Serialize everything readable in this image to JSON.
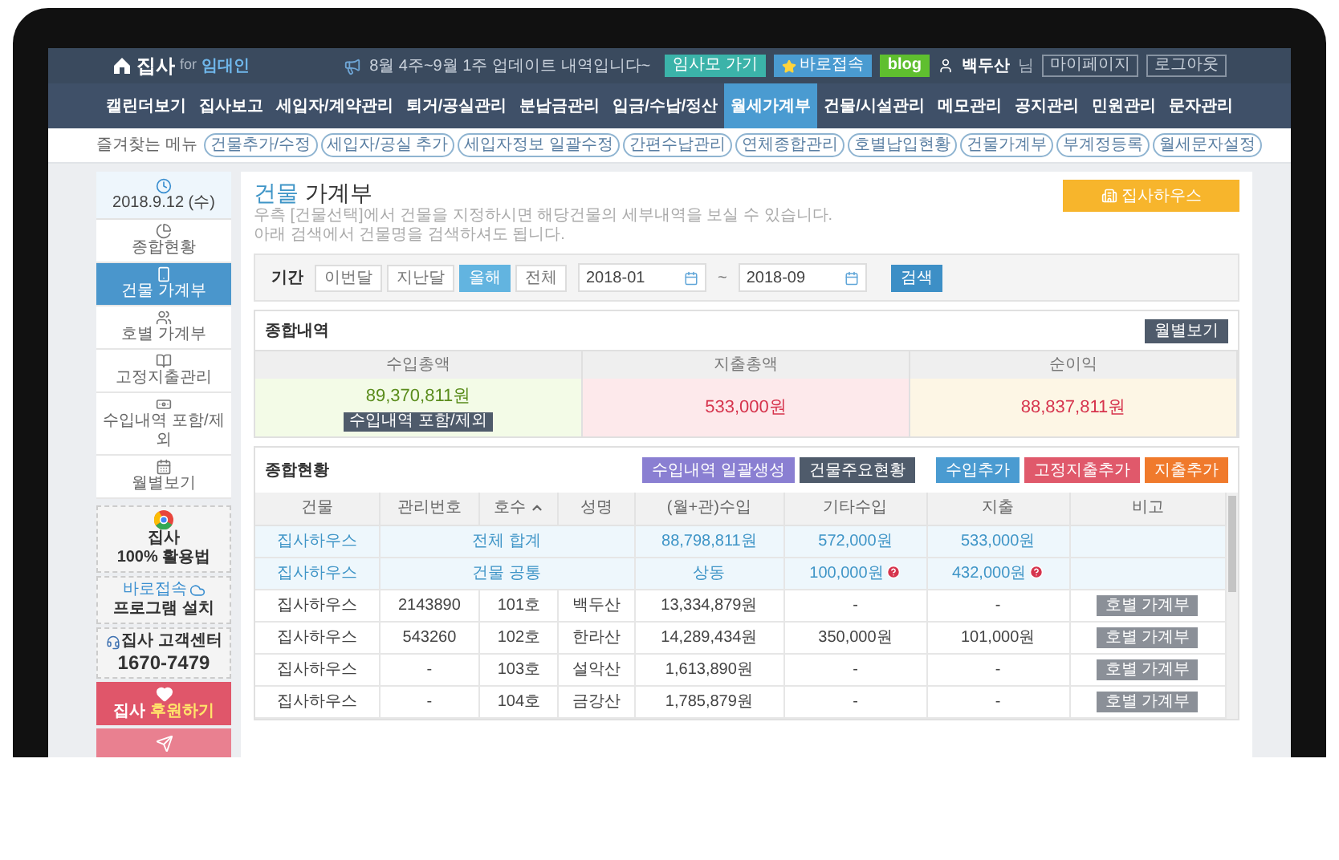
{
  "header": {
    "logo": "집사",
    "logo_for": "for",
    "logo_role": "임대인",
    "notice": "8월 4주~9월 1주 업데이트 내역입니다~",
    "links": [
      {
        "label": "임사모 가기",
        "kind": "community"
      },
      {
        "label": "바로접속",
        "kind": "quick"
      },
      {
        "label": "blog",
        "kind": "blog"
      }
    ],
    "user": "백두산",
    "user_suffix": "님",
    "account_links": [
      "마이페이지",
      "로그아웃"
    ]
  },
  "nav": [
    {
      "label": "캘린더보기",
      "selected": false
    },
    {
      "label": "집사보고",
      "selected": false
    },
    {
      "label": "세입자/계약관리",
      "selected": false
    },
    {
      "label": "퇴거/공실관리",
      "selected": false
    },
    {
      "label": "분납금관리",
      "selected": false
    },
    {
      "label": "입금/수납/정산",
      "selected": false
    },
    {
      "label": "월세가계부",
      "selected": true
    },
    {
      "label": "건물/시설관리",
      "selected": false
    },
    {
      "label": "메모관리",
      "selected": false
    },
    {
      "label": "공지관리",
      "selected": false
    },
    {
      "label": "민원관리",
      "selected": false
    },
    {
      "label": "문자관리",
      "selected": false
    }
  ],
  "favorites": {
    "label": "즐겨찾는 메뉴",
    "items": [
      "건물추가/수정",
      "세입자/공실 추가",
      "세입자정보 일괄수정",
      "간편수납관리",
      "연체종합관리",
      "호별납입현황",
      "건물가계부",
      "부계정등록",
      "월세문자설정"
    ]
  },
  "sidebar": {
    "date": "2018.9.12 (수)",
    "items": [
      {
        "label": "종합현황",
        "selected": false
      },
      {
        "label": "건물 가계부",
        "selected": true
      },
      {
        "label": "호별 가계부",
        "selected": false
      },
      {
        "label": "고정지출관리",
        "selected": false
      },
      {
        "label": "수입내역 포함/제외",
        "selected": false
      },
      {
        "label": "월별보기",
        "selected": false
      }
    ],
    "promos": [
      {
        "kind": "guide",
        "lines": [
          "집사",
          "100% 활용법"
        ]
      },
      {
        "kind": "install",
        "lines": [
          "바로접속",
          "프로그램 설치"
        ]
      },
      {
        "kind": "support",
        "lines": [
          "집사 고객센터",
          "1670-7479"
        ]
      },
      {
        "kind": "donate",
        "lines": [
          "집사",
          "후원하기"
        ]
      },
      {
        "kind": "recommend"
      }
    ]
  },
  "page": {
    "title_accent": "건물",
    "title_rest": "가계부",
    "description": [
      "우측 [건물선택]에서 건물을 지정하시면 해당건물의 세부내역을 보실 수 있습니다.",
      "아래 검색에서 건물명을 검색하셔도 됩니다."
    ],
    "building_button": "집사하우스",
    "filter": {
      "label": "기간",
      "presets": [
        {
          "label": "이번달",
          "selected": false
        },
        {
          "label": "지난달",
          "selected": false
        },
        {
          "label": "올해",
          "selected": true
        },
        {
          "label": "전체",
          "selected": false
        }
      ],
      "from": "2018-01",
      "separator": "~",
      "to": "2018-09",
      "search": "검색"
    },
    "overview": {
      "title": "종합내역",
      "button": "월별보기",
      "columns": [
        {
          "label": "수입총액",
          "value": "89,370,811원",
          "kind": "income",
          "button": "수입내역 포함/제외"
        },
        {
          "label": "지출총액",
          "value": "533,000원",
          "kind": "expense"
        },
        {
          "label": "순이익",
          "value": "88,837,811원",
          "kind": "profit"
        }
      ]
    },
    "status": {
      "title": "종합현황",
      "buttons": [
        {
          "label": "수입내역 일괄생성",
          "color": "#8a7fd2"
        },
        {
          "label": "건물주요현황",
          "color": "#4f5b6b"
        },
        {
          "label": "수입추가",
          "color": "#4a9bd1"
        },
        {
          "label": "고정지출추가",
          "color": "#e0596b"
        },
        {
          "label": "지출추가",
          "color": "#f07a2c"
        }
      ],
      "columns": [
        {
          "label": "건물",
          "sorted": false
        },
        {
          "label": "관리번호",
          "sorted": false
        },
        {
          "label": "호수",
          "sorted": true
        },
        {
          "label": "성명",
          "sorted": false
        },
        {
          "label": "(월+관)수입",
          "sorted": false
        },
        {
          "label": "기타수입",
          "sorted": false
        },
        {
          "label": "지출",
          "sorted": false
        },
        {
          "label": "비고",
          "sorted": false
        }
      ],
      "rows": [
        {
          "kind": "summary",
          "building": "집사하우스",
          "label": "전체 합계",
          "income": "88,798,811원",
          "other": "572,000원",
          "other_note": false,
          "expense": "533,000원",
          "expense_note": false
        },
        {
          "kind": "summary",
          "building": "집사하우스",
          "label": "건물 공통",
          "income": "상동",
          "other": "100,000원",
          "other_note": true,
          "expense": "432,000원",
          "expense_note": true
        },
        {
          "kind": "unit",
          "building": "집사하우스",
          "number": "2143890",
          "unit": "101호",
          "name": "백두산",
          "income": "13,334,879원",
          "other": "-",
          "expense": "-",
          "action": "호별 가계부"
        },
        {
          "kind": "unit",
          "building": "집사하우스",
          "number": "543260",
          "unit": "102호",
          "name": "한라산",
          "income": "14,289,434원",
          "other": "350,000원",
          "expense": "101,000원",
          "action": "호별 가계부"
        },
        {
          "kind": "unit",
          "building": "집사하우스",
          "number": "-",
          "unit": "103호",
          "name": "설악산",
          "income": "1,613,890원",
          "other": "-",
          "expense": "-",
          "action": "호별 가계부"
        },
        {
          "kind": "unit",
          "building": "집사하우스",
          "number": "-",
          "unit": "104호",
          "name": "금강산",
          "income": "1,785,879원",
          "other": "-",
          "expense": "-",
          "action": "호별 가계부"
        }
      ]
    }
  }
}
